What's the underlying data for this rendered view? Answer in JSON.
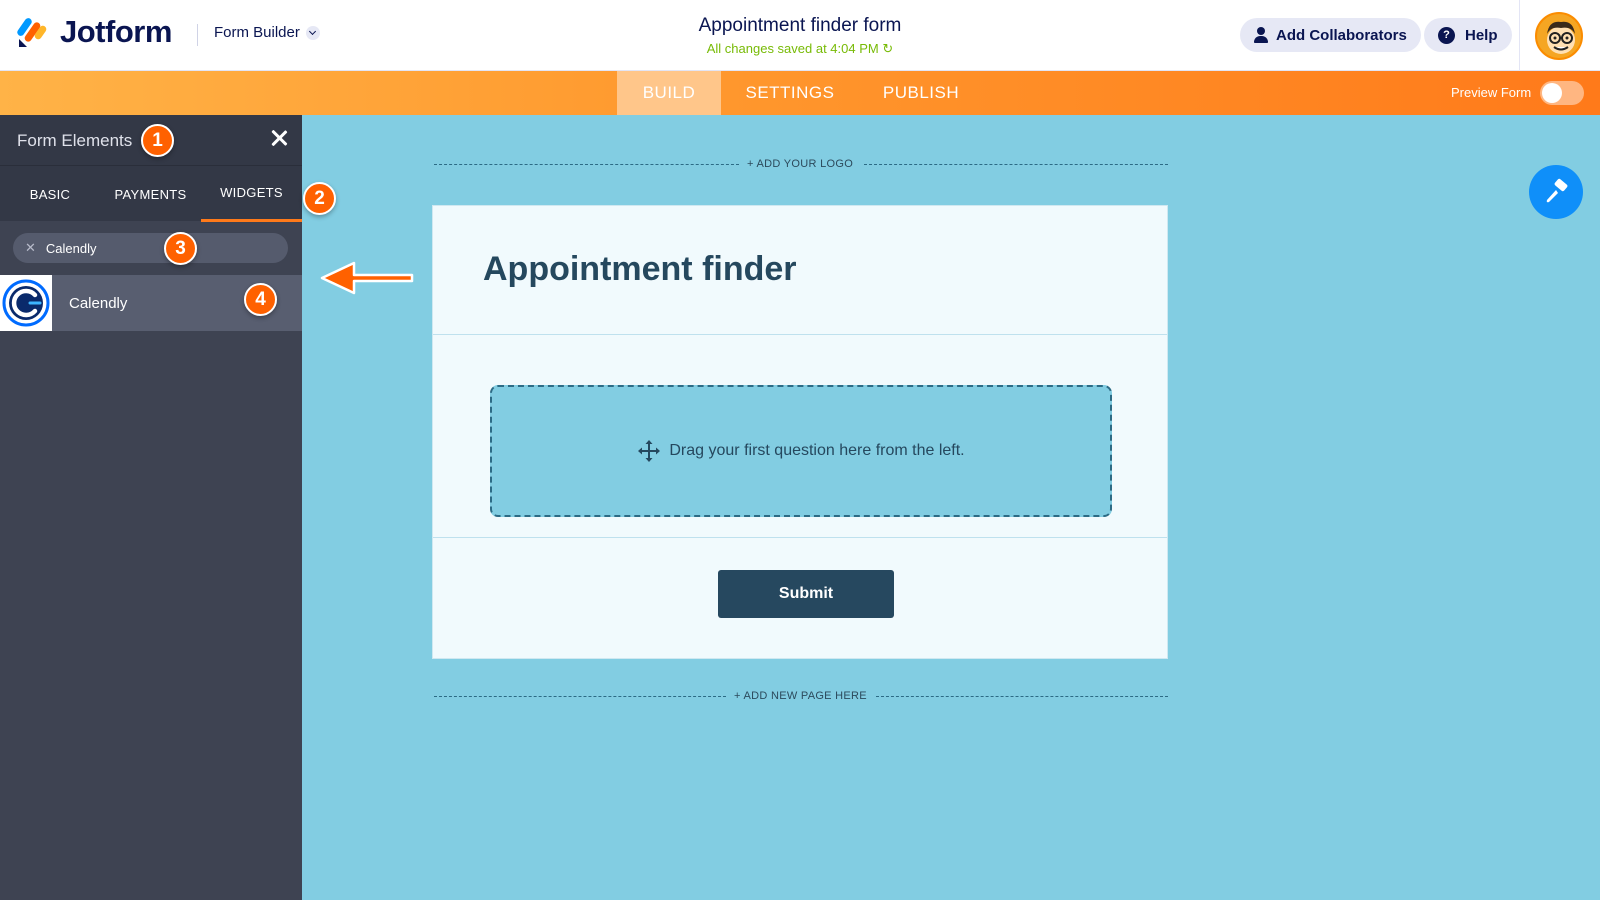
{
  "header": {
    "brand": "Jotform",
    "builder_menu": "Form Builder",
    "form_title": "Appointment finder form",
    "saved_status": "All changes saved at 4:04 PM",
    "add_collaborators": "Add Collaborators",
    "help": "Help"
  },
  "nav": {
    "tabs": [
      {
        "label": "BUILD",
        "active": true
      },
      {
        "label": "SETTINGS",
        "active": false
      },
      {
        "label": "PUBLISH",
        "active": false
      }
    ],
    "preview_label": "Preview Form",
    "preview_enabled": false
  },
  "sidebar": {
    "title": "Form Elements",
    "tabs": [
      {
        "label": "BASIC",
        "active": false
      },
      {
        "label": "PAYMENTS",
        "active": false
      },
      {
        "label": "WIDGETS",
        "active": true
      }
    ],
    "search_value": "Calendly",
    "results": [
      {
        "label": "Calendly",
        "icon": "calendly-icon"
      }
    ]
  },
  "callouts": [
    "1",
    "2",
    "3",
    "4"
  ],
  "canvas": {
    "add_logo": "+ ADD YOUR LOGO",
    "form_heading": "Appointment finder",
    "drop_hint": "Drag your first question here from the left.",
    "submit_label": "Submit",
    "add_page": "+ ADD NEW PAGE HERE"
  },
  "colors": {
    "accent_orange": "#ff6100",
    "canvas_bg": "#82cde2",
    "sidebar_bg": "#3e4352",
    "submit_bg": "#26485f",
    "saved_green": "#78bb07",
    "designer_blue": "#0f8ff9"
  }
}
